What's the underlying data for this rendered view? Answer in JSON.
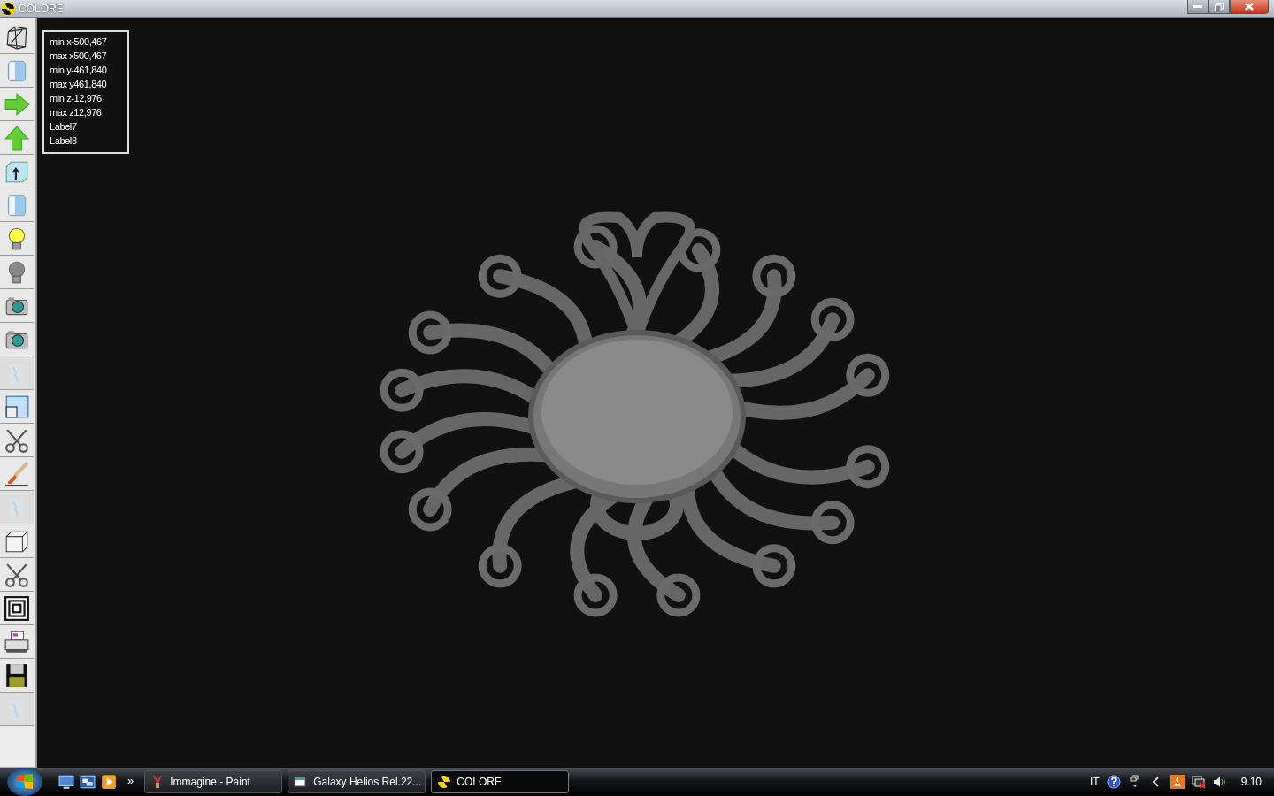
{
  "window": {
    "title": "COLORE"
  },
  "toolbar": {
    "buttons": [
      {
        "kind": "wireframe",
        "disabled": false
      },
      {
        "kind": "cylinder",
        "disabled": false
      },
      {
        "kind": "arrow-right",
        "disabled": false
      },
      {
        "kind": "arrow-up",
        "disabled": false
      },
      {
        "kind": "box-arrow",
        "disabled": false
      },
      {
        "kind": "cylinder",
        "disabled": false
      },
      {
        "kind": "bulb-on",
        "disabled": false
      },
      {
        "kind": "bulb-off",
        "disabled": false
      },
      {
        "kind": "camera",
        "disabled": false
      },
      {
        "kind": "camera",
        "disabled": false
      },
      {
        "kind": "texture",
        "disabled": true
      },
      {
        "kind": "windows",
        "disabled": false
      },
      {
        "kind": "scissors",
        "disabled": false
      },
      {
        "kind": "brush",
        "disabled": false
      },
      {
        "kind": "texture",
        "disabled": true
      },
      {
        "kind": "cube",
        "disabled": false
      },
      {
        "kind": "scissors",
        "disabled": false
      },
      {
        "kind": "squares",
        "disabled": false
      },
      {
        "kind": "printer",
        "disabled": false
      },
      {
        "kind": "floppy",
        "disabled": false
      },
      {
        "kind": "texture",
        "disabled": true
      }
    ]
  },
  "info_panel": {
    "lines": [
      "min x-500,467",
      "max x500,467",
      "min y-461,840",
      "max y461,840",
      "min z-12,976",
      "max z12,976",
      "Label7",
      "Label8"
    ]
  },
  "taskbar": {
    "quick_launch_more": "»",
    "tasks": [
      {
        "label": "Immagine - Paint",
        "kind": "paint",
        "selected": false
      },
      {
        "label": "Galaxy Helios  Rel.22...",
        "kind": "window",
        "selected": false
      },
      {
        "label": "COLORE",
        "kind": "radiation",
        "selected": true
      }
    ],
    "tray": {
      "language": "IT",
      "clock": "9.10"
    }
  }
}
